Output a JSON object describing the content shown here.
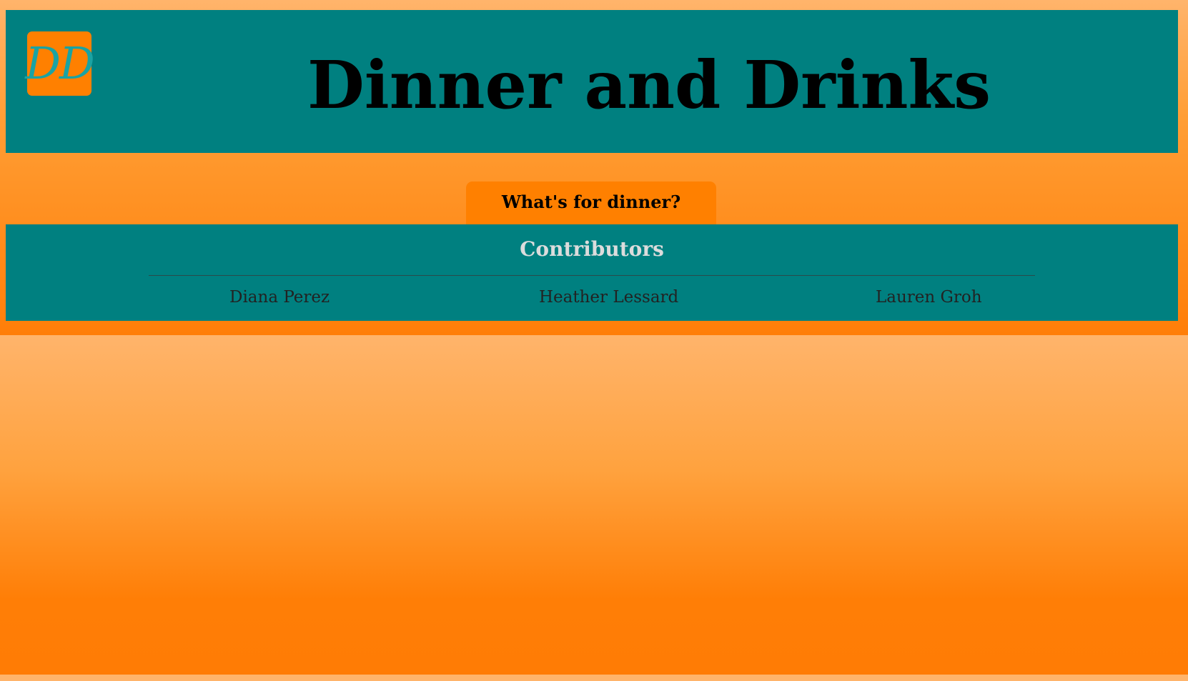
{
  "header": {
    "logo_text": "DD",
    "title": "Dinner and Drinks"
  },
  "nav": {
    "dinner_tab_label": "What's for dinner?"
  },
  "contributors": {
    "title": "Contributors",
    "names": [
      "Diana Perez",
      "Heather Lessard",
      "Lauren Groh"
    ]
  },
  "colors": {
    "teal": "#008080",
    "orange": "#ff8000",
    "peach": "#ffb46b",
    "logo_text": "#1aa3a3",
    "contributors_title": "#dcdcdc"
  }
}
